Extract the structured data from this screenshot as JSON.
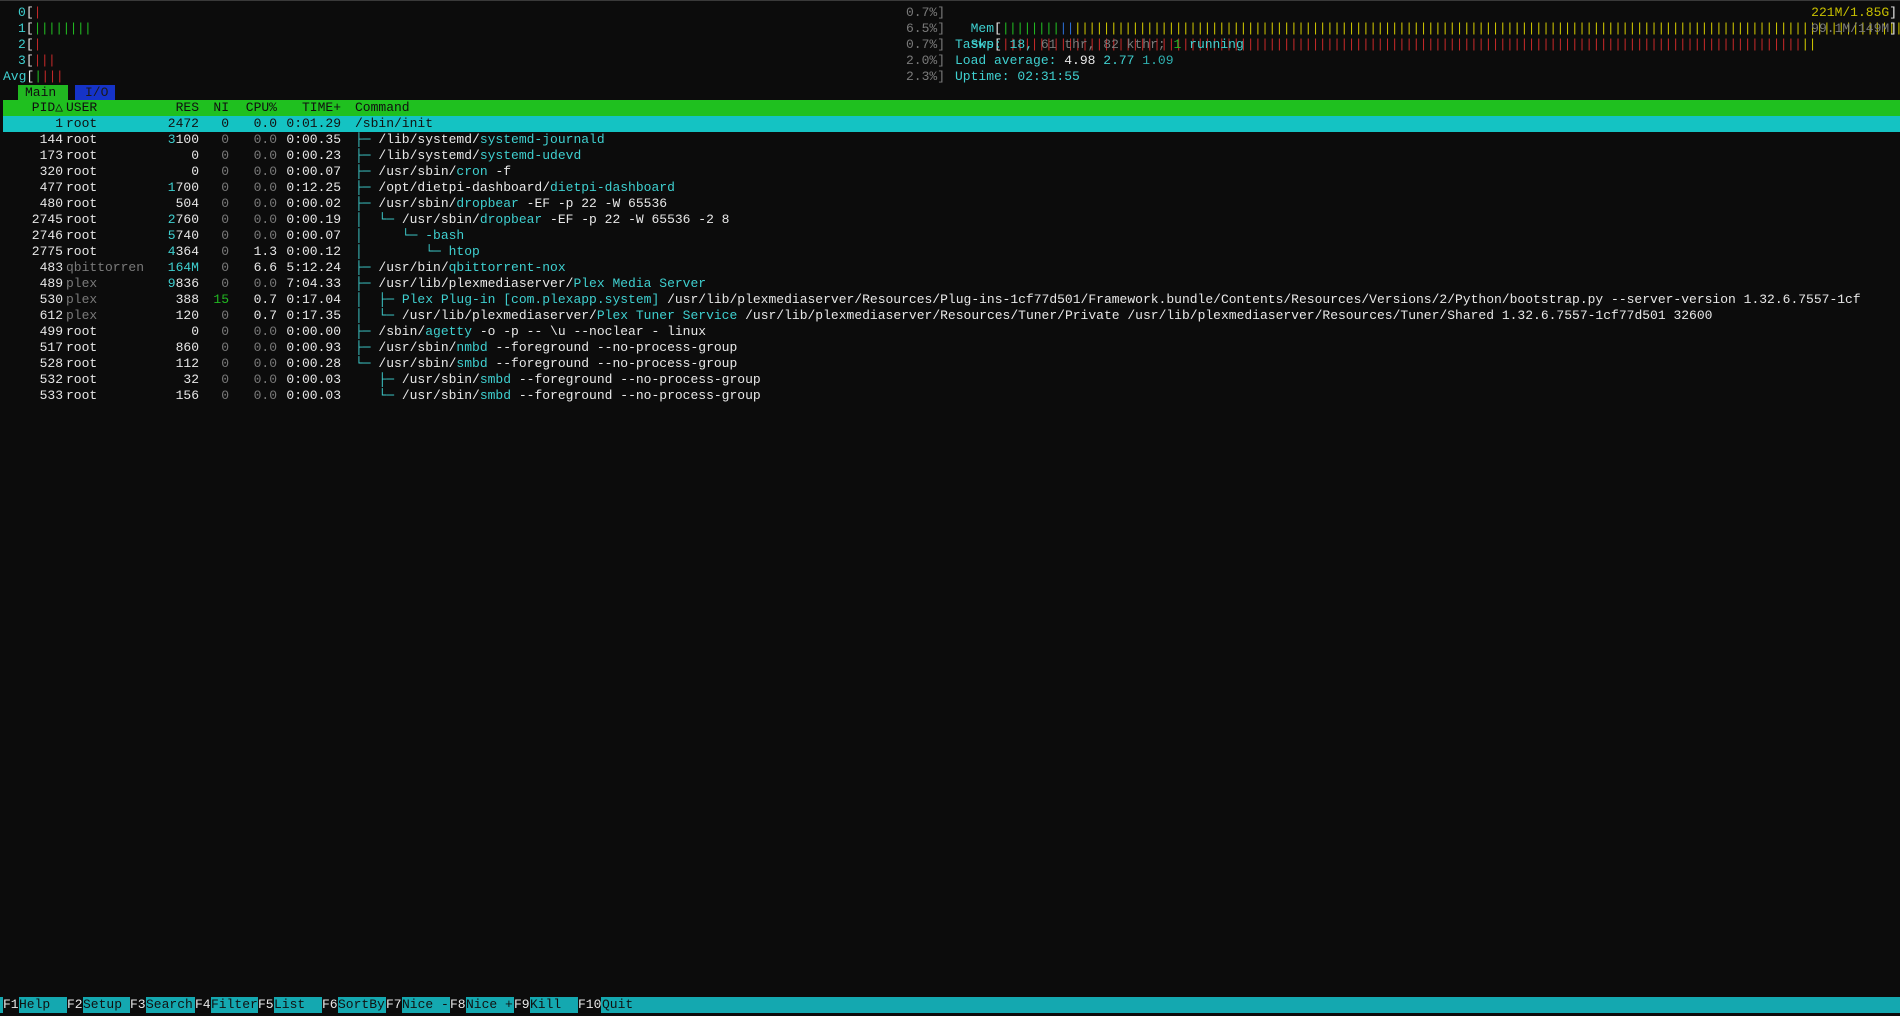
{
  "cpu_meters": [
    {
      "label": "0",
      "bar": "|",
      "colors": [
        "red"
      ]
    },
    {
      "label": "1",
      "bar": "||||||||",
      "colors": [
        "green"
      ]
    },
    {
      "label": "2",
      "bar": "|",
      "colors": [
        "red"
      ]
    },
    {
      "label": "3",
      "bar": "|||",
      "colors": [
        "red"
      ]
    },
    {
      "label": "Avg",
      "bar": "||||",
      "colors": [
        "mixed"
      ]
    }
  ],
  "right_meters": {
    "cpu_pct": [
      "0.7%]",
      "6.5%]",
      "0.7%]",
      "2.0%]",
      "2.3%]"
    ],
    "mem_label": "Mem",
    "mem_value": "221M/1.85G",
    "swp_label": "Swp",
    "swp_value": "99.1M/149M",
    "tasks_label": "Tasks:",
    "tasks_count": "18",
    "tasks_thr": "61 thr,",
    "tasks_kthr": "82 kthr;",
    "tasks_running_count": "1",
    "tasks_running": "running",
    "load_label": "Load average:",
    "load_1": "4.98",
    "load_5": "2.77",
    "load_15": "1.09",
    "uptime_label": "Uptime:",
    "uptime": "02:31:55"
  },
  "tabs": {
    "main": "Main",
    "io": "I/O"
  },
  "columns": {
    "pid": "PID△",
    "user": "USER",
    "res": "RES",
    "ni": "NI",
    "cpu": "CPU%",
    "time": "TIME+",
    "command": "Command"
  },
  "processes": [
    {
      "pid": "1",
      "user": "root",
      "res": "2472",
      "ni": "0",
      "cpu": "0.0",
      "time": "0:01.29",
      "tree": "",
      "cmd_dir": "/sbin/init",
      "cmd_name": "",
      "cmd_args": ""
    },
    {
      "pid": "144",
      "user": "root",
      "res": "3100",
      "ni": "0",
      "cpu": "0.0",
      "time": "0:00.35",
      "tree": "├─ ",
      "cmd_dir": "/lib/systemd/",
      "cmd_name": "systemd-journald",
      "cmd_args": ""
    },
    {
      "pid": "173",
      "user": "root",
      "res": "0",
      "ni": "0",
      "cpu": "0.0",
      "time": "0:00.23",
      "tree": "├─ ",
      "cmd_dir": "/lib/systemd/",
      "cmd_name": "systemd-udevd",
      "cmd_args": ""
    },
    {
      "pid": "320",
      "user": "root",
      "res": "0",
      "ni": "0",
      "cpu": "0.0",
      "time": "0:00.07",
      "tree": "├─ ",
      "cmd_dir": "/usr/sbin/",
      "cmd_name": "cron",
      "cmd_args": " -f"
    },
    {
      "pid": "477",
      "user": "root",
      "res": "1700",
      "ni": "0",
      "cpu": "0.0",
      "time": "0:12.25",
      "tree": "├─ ",
      "cmd_dir": "/opt/dietpi-dashboard/",
      "cmd_name": "dietpi-dashboard",
      "cmd_args": ""
    },
    {
      "pid": "480",
      "user": "root",
      "res": "504",
      "ni": "0",
      "cpu": "0.0",
      "time": "0:00.02",
      "tree": "├─ ",
      "cmd_dir": "/usr/sbin/",
      "cmd_name": "dropbear",
      "cmd_args": " -EF -p 22 -W 65536"
    },
    {
      "pid": "2745",
      "user": "root",
      "res": "2760",
      "ni": "0",
      "cpu": "0.0",
      "time": "0:00.19",
      "tree": "│  └─ ",
      "cmd_dir": "/usr/sbin/",
      "cmd_name": "dropbear",
      "cmd_args": " -EF -p 22 -W 65536 -2 8"
    },
    {
      "pid": "2746",
      "user": "root",
      "res": "5740",
      "ni": "0",
      "cpu": "0.0",
      "time": "0:00.07",
      "tree": "│     └─ ",
      "cmd_dir": "",
      "cmd_name": "-bash",
      "cmd_args": ""
    },
    {
      "pid": "2775",
      "user": "root",
      "res": "4364",
      "ni": "0",
      "cpu": "1.3",
      "time": "0:00.12",
      "tree": "│        └─ ",
      "cmd_dir": "",
      "cmd_name": "htop",
      "cmd_args": ""
    },
    {
      "pid": "483",
      "user": "qbittorren",
      "res": "164M",
      "ni": "0",
      "cpu": "6.6",
      "time": "5:12.24",
      "tree": "├─ ",
      "cmd_dir": "/usr/bin/",
      "cmd_name": "qbittorrent-nox",
      "cmd_args": ""
    },
    {
      "pid": "489",
      "user": "plex",
      "res": "9836",
      "ni": "0",
      "cpu": "0.0",
      "time": "7:04.33",
      "tree": "├─ ",
      "cmd_dir": "/usr/lib/plexmediaserver/",
      "cmd_name": "Plex Media Server",
      "cmd_args": ""
    },
    {
      "pid": "530",
      "user": "plex",
      "res": "388",
      "ni": "15",
      "cpu": "0.7",
      "time": "0:17.04",
      "tree": "│  ├─ ",
      "cmd_dir": "",
      "cmd_name": "Plex Plug-in [com.plexapp.system]",
      "cmd_args": " /usr/lib/plexmediaserver/Resources/Plug-ins-1cf77d501/Framework.bundle/Contents/Resources/Versions/2/Python/bootstrap.py --server-version 1.32.6.7557-1cf"
    },
    {
      "pid": "612",
      "user": "plex",
      "res": "120",
      "ni": "0",
      "cpu": "0.7",
      "time": "0:17.35",
      "tree": "│  └─ ",
      "cmd_dir": "/usr/lib/plexmediaserver/",
      "cmd_name": "Plex Tuner Service",
      "cmd_args": " /usr/lib/plexmediaserver/Resources/Tuner/Private /usr/lib/plexmediaserver/Resources/Tuner/Shared 1.32.6.7557-1cf77d501 32600"
    },
    {
      "pid": "499",
      "user": "root",
      "res": "0",
      "ni": "0",
      "cpu": "0.0",
      "time": "0:00.00",
      "tree": "├─ ",
      "cmd_dir": "/sbin/",
      "cmd_name": "agetty",
      "cmd_args": " -o -p -- \\u --noclear - linux"
    },
    {
      "pid": "517",
      "user": "root",
      "res": "860",
      "ni": "0",
      "cpu": "0.0",
      "time": "0:00.93",
      "tree": "├─ ",
      "cmd_dir": "/usr/sbin/",
      "cmd_name": "nmbd",
      "cmd_args": " --foreground --no-process-group"
    },
    {
      "pid": "528",
      "user": "root",
      "res": "112",
      "ni": "0",
      "cpu": "0.0",
      "time": "0:00.28",
      "tree": "└─ ",
      "cmd_dir": "/usr/sbin/",
      "cmd_name": "smbd",
      "cmd_args": " --foreground --no-process-group"
    },
    {
      "pid": "532",
      "user": "root",
      "res": "32",
      "ni": "0",
      "cpu": "0.0",
      "time": "0:00.03",
      "tree": "   ├─ ",
      "cmd_dir": "/usr/sbin/",
      "cmd_name": "smbd",
      "cmd_args": " --foreground --no-process-group"
    },
    {
      "pid": "533",
      "user": "root",
      "res": "156",
      "ni": "0",
      "cpu": "0.0",
      "time": "0:00.03",
      "tree": "   └─ ",
      "cmd_dir": "/usr/sbin/",
      "cmd_name": "smbd",
      "cmd_args": " --foreground --no-process-group"
    }
  ],
  "footer": [
    {
      "key": "F1",
      "label": "Help"
    },
    {
      "key": "F2",
      "label": "Setup"
    },
    {
      "key": "F3",
      "label": "Search"
    },
    {
      "key": "F4",
      "label": "Filter"
    },
    {
      "key": "F5",
      "label": "List"
    },
    {
      "key": "F6",
      "label": "SortBy"
    },
    {
      "key": "F7",
      "label": "Nice -"
    },
    {
      "key": "F8",
      "label": "Nice +"
    },
    {
      "key": "F9",
      "label": "Kill"
    },
    {
      "key": "F10",
      "label": "Quit"
    }
  ],
  "colors": {
    "header_bg": "#1fc01f",
    "selection_bg": "#14c3c3",
    "footer_bg": "#14a8b0",
    "accent_cyan": "#3fd0d0"
  }
}
